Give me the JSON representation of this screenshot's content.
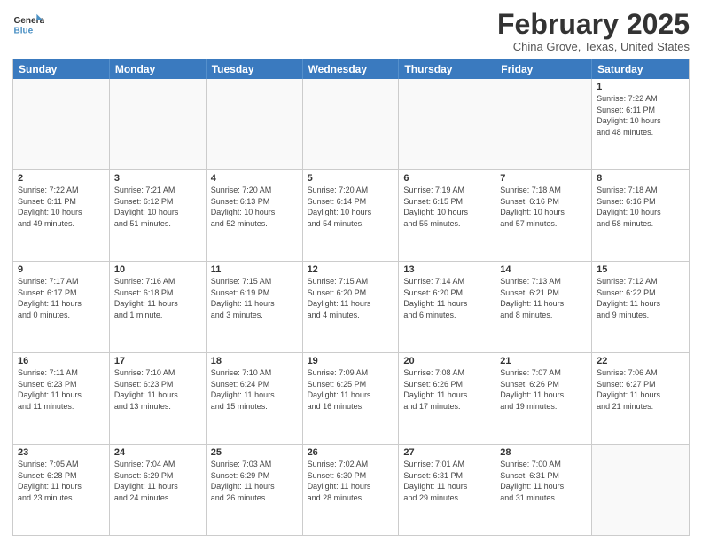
{
  "header": {
    "logo_general": "General",
    "logo_blue": "Blue",
    "month_title": "February 2025",
    "location": "China Grove, Texas, United States"
  },
  "calendar": {
    "days_of_week": [
      "Sunday",
      "Monday",
      "Tuesday",
      "Wednesday",
      "Thursday",
      "Friday",
      "Saturday"
    ],
    "rows": [
      [
        {
          "day": "",
          "detail": "",
          "empty": true
        },
        {
          "day": "",
          "detail": "",
          "empty": true
        },
        {
          "day": "",
          "detail": "",
          "empty": true
        },
        {
          "day": "",
          "detail": "",
          "empty": true
        },
        {
          "day": "",
          "detail": "",
          "empty": true
        },
        {
          "day": "",
          "detail": "",
          "empty": true
        },
        {
          "day": "1",
          "detail": "Sunrise: 7:22 AM\nSunset: 6:11 PM\nDaylight: 10 hours\nand 48 minutes.",
          "empty": false
        }
      ],
      [
        {
          "day": "2",
          "detail": "Sunrise: 7:22 AM\nSunset: 6:11 PM\nDaylight: 10 hours\nand 49 minutes.",
          "empty": false
        },
        {
          "day": "3",
          "detail": "Sunrise: 7:21 AM\nSunset: 6:12 PM\nDaylight: 10 hours\nand 51 minutes.",
          "empty": false
        },
        {
          "day": "4",
          "detail": "Sunrise: 7:20 AM\nSunset: 6:13 PM\nDaylight: 10 hours\nand 52 minutes.",
          "empty": false
        },
        {
          "day": "5",
          "detail": "Sunrise: 7:20 AM\nSunset: 6:14 PM\nDaylight: 10 hours\nand 54 minutes.",
          "empty": false
        },
        {
          "day": "6",
          "detail": "Sunrise: 7:19 AM\nSunset: 6:15 PM\nDaylight: 10 hours\nand 55 minutes.",
          "empty": false
        },
        {
          "day": "7",
          "detail": "Sunrise: 7:18 AM\nSunset: 6:16 PM\nDaylight: 10 hours\nand 57 minutes.",
          "empty": false
        },
        {
          "day": "8",
          "detail": "Sunrise: 7:18 AM\nSunset: 6:16 PM\nDaylight: 10 hours\nand 58 minutes.",
          "empty": false
        }
      ],
      [
        {
          "day": "9",
          "detail": "Sunrise: 7:17 AM\nSunset: 6:17 PM\nDaylight: 11 hours\nand 0 minutes.",
          "empty": false
        },
        {
          "day": "10",
          "detail": "Sunrise: 7:16 AM\nSunset: 6:18 PM\nDaylight: 11 hours\nand 1 minute.",
          "empty": false
        },
        {
          "day": "11",
          "detail": "Sunrise: 7:15 AM\nSunset: 6:19 PM\nDaylight: 11 hours\nand 3 minutes.",
          "empty": false
        },
        {
          "day": "12",
          "detail": "Sunrise: 7:15 AM\nSunset: 6:20 PM\nDaylight: 11 hours\nand 4 minutes.",
          "empty": false
        },
        {
          "day": "13",
          "detail": "Sunrise: 7:14 AM\nSunset: 6:20 PM\nDaylight: 11 hours\nand 6 minutes.",
          "empty": false
        },
        {
          "day": "14",
          "detail": "Sunrise: 7:13 AM\nSunset: 6:21 PM\nDaylight: 11 hours\nand 8 minutes.",
          "empty": false
        },
        {
          "day": "15",
          "detail": "Sunrise: 7:12 AM\nSunset: 6:22 PM\nDaylight: 11 hours\nand 9 minutes.",
          "empty": false
        }
      ],
      [
        {
          "day": "16",
          "detail": "Sunrise: 7:11 AM\nSunset: 6:23 PM\nDaylight: 11 hours\nand 11 minutes.",
          "empty": false
        },
        {
          "day": "17",
          "detail": "Sunrise: 7:10 AM\nSunset: 6:23 PM\nDaylight: 11 hours\nand 13 minutes.",
          "empty": false
        },
        {
          "day": "18",
          "detail": "Sunrise: 7:10 AM\nSunset: 6:24 PM\nDaylight: 11 hours\nand 15 minutes.",
          "empty": false
        },
        {
          "day": "19",
          "detail": "Sunrise: 7:09 AM\nSunset: 6:25 PM\nDaylight: 11 hours\nand 16 minutes.",
          "empty": false
        },
        {
          "day": "20",
          "detail": "Sunrise: 7:08 AM\nSunset: 6:26 PM\nDaylight: 11 hours\nand 17 minutes.",
          "empty": false
        },
        {
          "day": "21",
          "detail": "Sunrise: 7:07 AM\nSunset: 6:26 PM\nDaylight: 11 hours\nand 19 minutes.",
          "empty": false
        },
        {
          "day": "22",
          "detail": "Sunrise: 7:06 AM\nSunset: 6:27 PM\nDaylight: 11 hours\nand 21 minutes.",
          "empty": false
        }
      ],
      [
        {
          "day": "23",
          "detail": "Sunrise: 7:05 AM\nSunset: 6:28 PM\nDaylight: 11 hours\nand 23 minutes.",
          "empty": false
        },
        {
          "day": "24",
          "detail": "Sunrise: 7:04 AM\nSunset: 6:29 PM\nDaylight: 11 hours\nand 24 minutes.",
          "empty": false
        },
        {
          "day": "25",
          "detail": "Sunrise: 7:03 AM\nSunset: 6:29 PM\nDaylight: 11 hours\nand 26 minutes.",
          "empty": false
        },
        {
          "day": "26",
          "detail": "Sunrise: 7:02 AM\nSunset: 6:30 PM\nDaylight: 11 hours\nand 28 minutes.",
          "empty": false
        },
        {
          "day": "27",
          "detail": "Sunrise: 7:01 AM\nSunset: 6:31 PM\nDaylight: 11 hours\nand 29 minutes.",
          "empty": false
        },
        {
          "day": "28",
          "detail": "Sunrise: 7:00 AM\nSunset: 6:31 PM\nDaylight: 11 hours\nand 31 minutes.",
          "empty": false
        },
        {
          "day": "",
          "detail": "",
          "empty": true
        }
      ]
    ]
  }
}
